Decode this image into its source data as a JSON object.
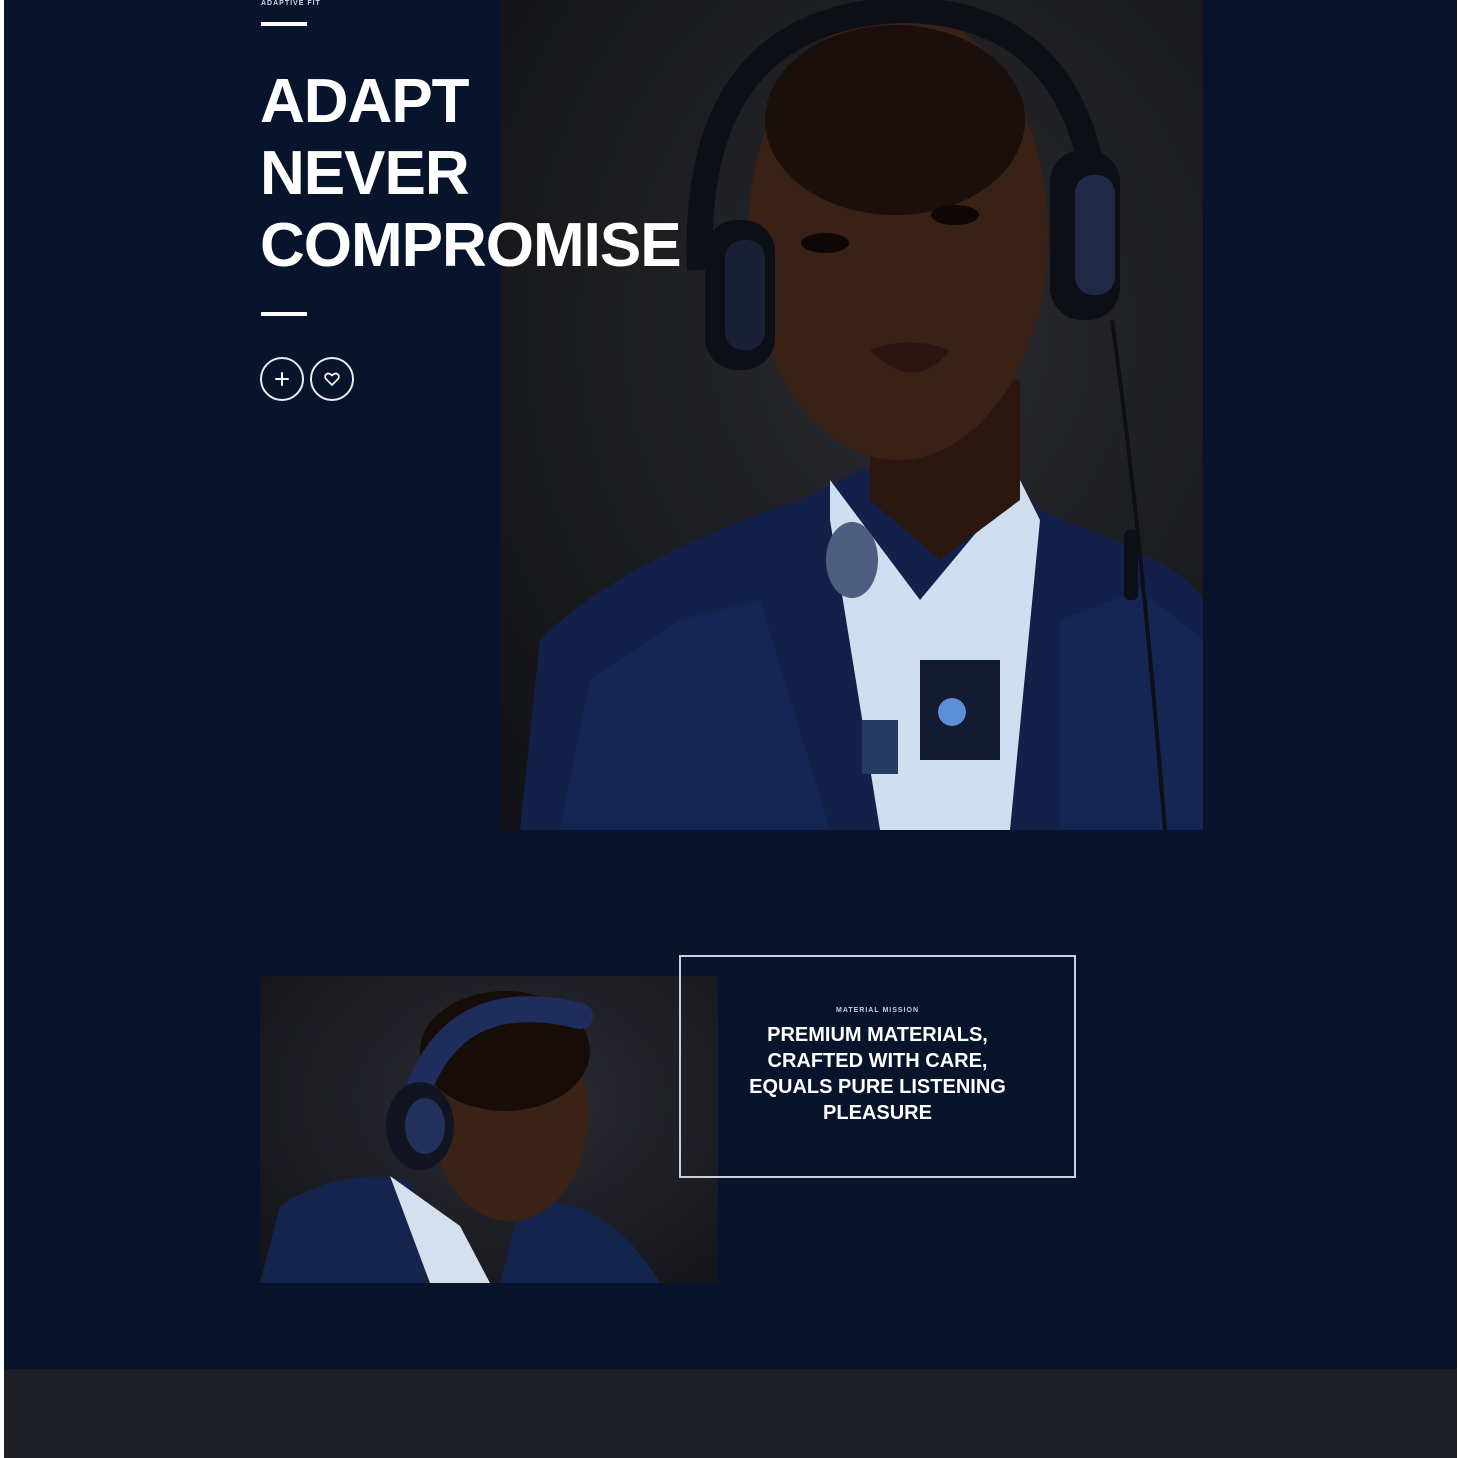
{
  "hero": {
    "eyebrow": "ADAPTIVE FIT",
    "headline_lines": [
      "ADAPT",
      "NEVER",
      "COMPROMISE"
    ],
    "actions": [
      {
        "icon": "plus-icon"
      },
      {
        "icon": "heart-icon"
      }
    ]
  },
  "feature": {
    "eyebrow": "MATERIAL MISSION",
    "text": "PREMIUM MATERIALS, CRAFTED WITH CARE, EQUALS PURE LISTENING PLEASURE"
  },
  "colors": {
    "background": "#08142b",
    "accent": "#ffffff",
    "footer": "#1d1f24"
  }
}
